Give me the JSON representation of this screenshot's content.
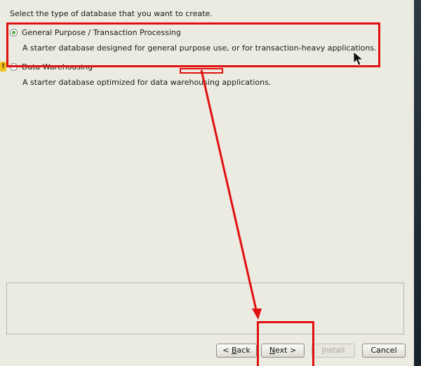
{
  "heading": "Select the type of database that you want to create.",
  "options": [
    {
      "label": "General Purpose / Transaction Processing",
      "description": "A starter database designed for general purpose use, or for transaction-heavy applications.",
      "selected": true
    },
    {
      "label": "Data Warehousing",
      "description": "A starter database optimized for data warehousing applications.",
      "selected": false
    }
  ],
  "buttons": {
    "back_prefix": "< ",
    "back_mnemonic": "B",
    "back_rest": "ack",
    "next_mnemonic": "N",
    "next_rest": "ext >",
    "install_mnemonic": "I",
    "install_rest": "nstall",
    "install_enabled": false,
    "cancel": "Cancel"
  },
  "colors": {
    "annotation": "#e01010",
    "radio_selected": "#5aaa3c",
    "window_bg": "#ecebe1"
  },
  "icons": {
    "warning": "warning-icon",
    "cursor": "mouse-cursor-icon"
  }
}
